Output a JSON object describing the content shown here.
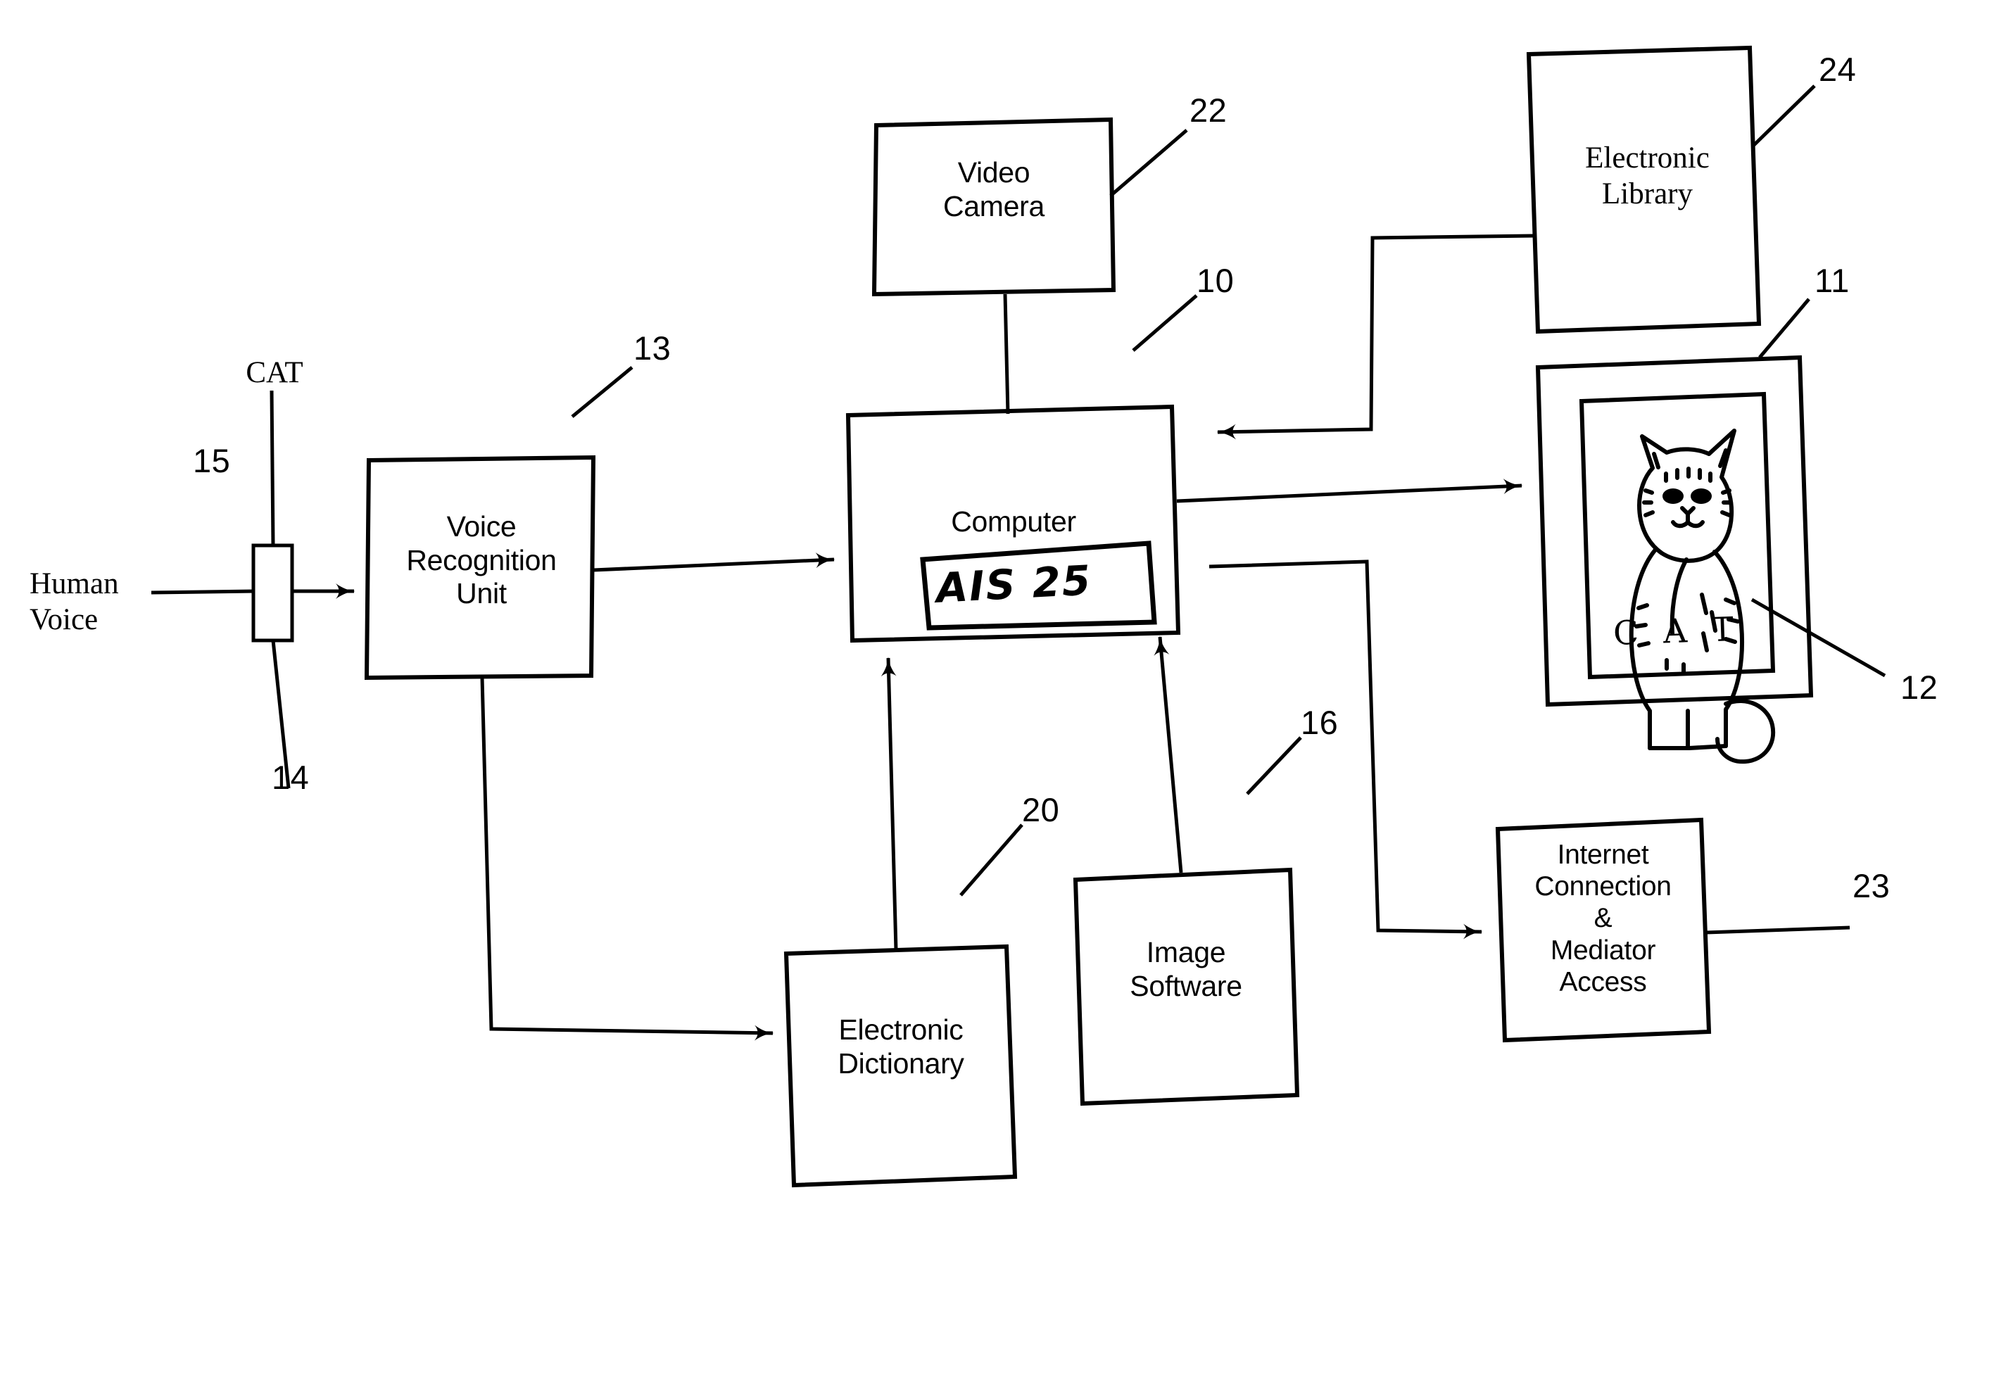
{
  "figure": {
    "type": "patent-block-diagram",
    "background": "#ffffff",
    "ink": "#000000"
  },
  "external_labels": {
    "human_voice": "Human\nVoice",
    "cat_input": "CAT"
  },
  "blocks": [
    {
      "id": "voice_recognition_unit",
      "label": "Voice\nRecognition\nUnit",
      "font": "sans",
      "ref": "13"
    },
    {
      "id": "video_camera",
      "label": "Video\nCamera",
      "font": "sans",
      "ref": "22"
    },
    {
      "id": "computer",
      "label": "Computer",
      "font": "sans",
      "ref": "10",
      "handwritten_note": "AIS 25"
    },
    {
      "id": "electronic_library",
      "label": "Electronic\nLibrary",
      "font": "serif",
      "ref": "24"
    },
    {
      "id": "electronic_dictionary",
      "label": "Electronic\nDictionary",
      "font": "sans",
      "ref": "20"
    },
    {
      "id": "image_software",
      "label": "Image\nSoftware",
      "font": "sans",
      "ref": "16"
    },
    {
      "id": "internet_connection",
      "label": "Internet\nConnection\n&\nMediator\nAccess",
      "font": "sans",
      "ref": "23"
    },
    {
      "id": "display_frame",
      "label": "",
      "font": "none",
      "ref": "11"
    }
  ],
  "reference_numerals": [
    {
      "num": "10",
      "points_to": "computer"
    },
    {
      "num": "11",
      "points_to": "display_frame"
    },
    {
      "num": "12",
      "points_to": "cat_drawing"
    },
    {
      "num": "13",
      "points_to": "voice_recognition_unit"
    },
    {
      "num": "14",
      "points_to": "microphone_lower_lead"
    },
    {
      "num": "15",
      "points_to": "microphone_upper_lead"
    },
    {
      "num": "16",
      "points_to": "computer_to_internet_link"
    },
    {
      "num": "20",
      "points_to": "electronic_dictionary"
    },
    {
      "num": "22",
      "points_to": "video_camera"
    },
    {
      "num": "23",
      "points_to": "internet_output_line"
    },
    {
      "num": "24",
      "points_to": "electronic_library"
    }
  ],
  "display_frame": {
    "drawing": "sitting-cat-line-drawing",
    "caption": "C A T"
  },
  "computer_screen_note": {
    "text": "AIS 25",
    "style": "handwritten"
  },
  "connections": [
    {
      "from": "microphone",
      "to": "voice_recognition_unit",
      "arrow": true
    },
    {
      "from": "voice_recognition_unit",
      "to": "computer",
      "arrow": true
    },
    {
      "from": "voice_recognition_unit",
      "to": "electronic_dictionary",
      "arrow": true
    },
    {
      "from": "video_camera",
      "to": "computer",
      "arrow": false
    },
    {
      "from": "electronic_library",
      "to": "computer",
      "arrow": true
    },
    {
      "from": "electronic_dictionary",
      "to": "computer",
      "arrow": true
    },
    {
      "from": "image_software",
      "to": "computer",
      "arrow": true
    },
    {
      "from": "computer",
      "to": "display_frame",
      "arrow": true
    },
    {
      "from": "computer",
      "to": "internet_connection",
      "arrow": true
    },
    {
      "from": "internet_connection",
      "to": "external_line_23",
      "arrow": false
    }
  ]
}
